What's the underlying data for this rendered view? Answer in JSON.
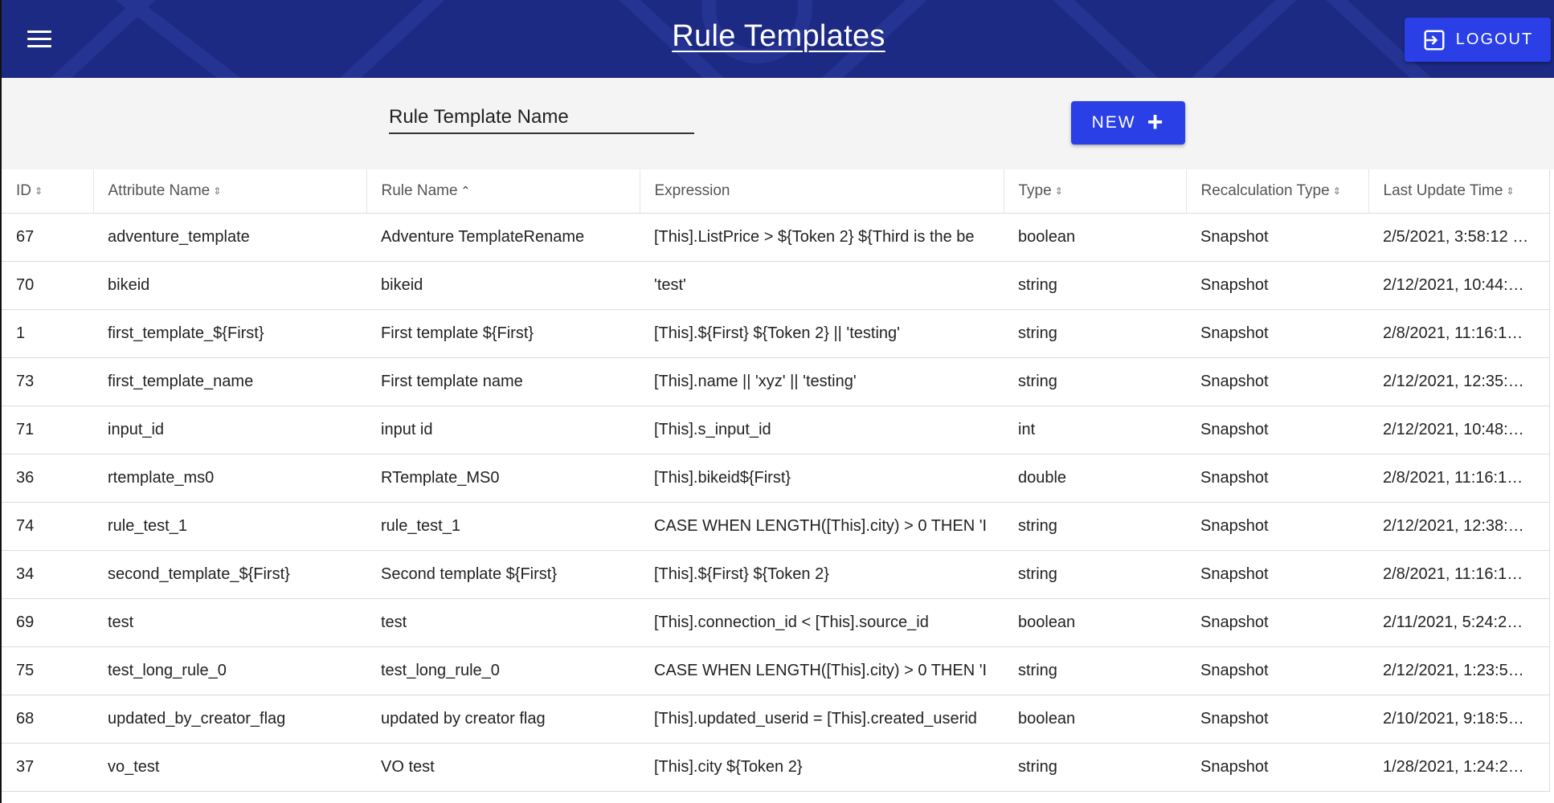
{
  "header": {
    "title": "Rule Templates",
    "logout_label": "LOGOUT"
  },
  "toolbar": {
    "search_placeholder": "Rule Template Name",
    "new_label": "NEW"
  },
  "table": {
    "columns": [
      {
        "label": "ID",
        "sort": "both"
      },
      {
        "label": "Attribute Name",
        "sort": "both"
      },
      {
        "label": "Rule Name",
        "sort": "asc"
      },
      {
        "label": "Expression",
        "sort": "none"
      },
      {
        "label": "Type",
        "sort": "both"
      },
      {
        "label": "Recalculation Type",
        "sort": "both"
      },
      {
        "label": "Last Update Time",
        "sort": "both"
      }
    ],
    "rows": [
      [
        "67",
        "adventure_template",
        "Adventure TemplateRename",
        "[This].ListPrice > ${Token 2} ${Third is the be",
        "boolean",
        "Snapshot",
        "2/5/2021, 3:58:12 …"
      ],
      [
        "70",
        "bikeid",
        "bikeid",
        "'test'",
        "string",
        "Snapshot",
        "2/12/2021, 10:44:…"
      ],
      [
        "1",
        "first_template_${First}",
        "First template ${First}",
        "[This].${First} ${Token 2} || 'testing'",
        "string",
        "Snapshot",
        "2/8/2021, 11:16:1…"
      ],
      [
        "73",
        "first_template_name",
        "First template name",
        "[This].name || 'xyz' || 'testing'",
        "string",
        "Snapshot",
        "2/12/2021, 12:35:…"
      ],
      [
        "71",
        "input_id",
        "input id",
        "[This].s_input_id",
        "int",
        "Snapshot",
        "2/12/2021, 10:48:…"
      ],
      [
        "36",
        "rtemplate_ms0",
        "RTemplate_MS0",
        "[This].bikeid${First}",
        "double",
        "Snapshot",
        "2/8/2021, 11:16:1…"
      ],
      [
        "74",
        "rule_test_1",
        "rule_test_1",
        "CASE WHEN LENGTH([This].city) > 0 THEN 'I",
        "string",
        "Snapshot",
        "2/12/2021, 12:38:…"
      ],
      [
        "34",
        "second_template_${First}",
        "Second template ${First}",
        "[This].${First} ${Token 2}",
        "string",
        "Snapshot",
        "2/8/2021, 11:16:1…"
      ],
      [
        "69",
        "test",
        "test",
        "[This].connection_id < [This].source_id",
        "boolean",
        "Snapshot",
        "2/11/2021, 5:24:2…"
      ],
      [
        "75",
        "test_long_rule_0",
        "test_long_rule_0",
        "CASE WHEN LENGTH([This].city) > 0 THEN 'I",
        "string",
        "Snapshot",
        "2/12/2021, 1:23:5…"
      ],
      [
        "68",
        "updated_by_creator_flag",
        "updated by creator flag",
        "[This].updated_userid = [This].created_userid",
        "boolean",
        "Snapshot",
        "2/10/2021, 9:18:5…"
      ],
      [
        "37",
        "vo_test",
        "VO test",
        "[This].city ${Token 2}",
        "string",
        "Snapshot",
        "1/28/2021, 1:24:2…"
      ]
    ]
  }
}
